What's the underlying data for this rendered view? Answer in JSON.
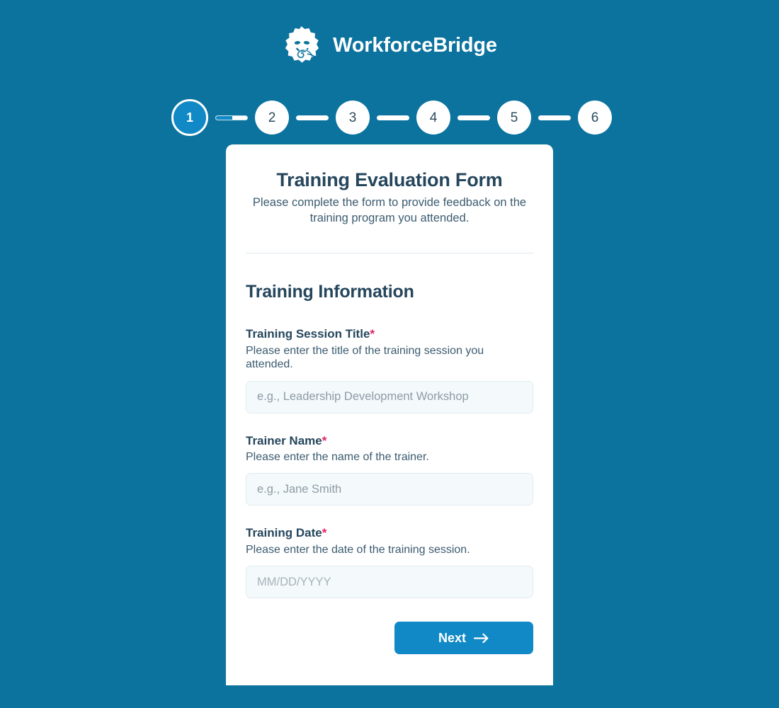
{
  "brand": {
    "name": "WorkforceBridge",
    "logo_icon": "gear-face-logo-icon"
  },
  "stepper": {
    "current_step": 1,
    "total_steps": 6,
    "steps": [
      {
        "label": "1",
        "state": "active"
      },
      {
        "label": "2",
        "state": "upcoming"
      },
      {
        "label": "3",
        "state": "upcoming"
      },
      {
        "label": "4",
        "state": "upcoming"
      },
      {
        "label": "5",
        "state": "upcoming"
      },
      {
        "label": "6",
        "state": "upcoming"
      }
    ]
  },
  "form": {
    "title": "Training Evaluation Form",
    "subtitle": "Please complete the form to provide feedback on the training program you attended.",
    "section_heading": "Training Information",
    "required_marker": "*",
    "fields": [
      {
        "label": "Training Session Title",
        "help": "Please enter the title of the training session you attended.",
        "placeholder": "e.g., Leadership Development Workshop",
        "value": "",
        "required": true
      },
      {
        "label": "Trainer Name",
        "help": "Please enter the name of the trainer.",
        "placeholder": "e.g., Jane Smith",
        "value": "",
        "required": true
      },
      {
        "label": "Training Date",
        "help": "Please enter the date of the training session.",
        "placeholder": "MM/DD/YYYY",
        "value": "",
        "required": true
      }
    ],
    "next_label": "Next",
    "next_icon": "arrow-right-icon"
  },
  "colors": {
    "page_background": "#0b739e",
    "accent_blue": "#1189c6",
    "heading_text": "#25465c",
    "body_text": "#3b5b70",
    "required_star": "#e51f62",
    "input_background": "#f4f9fb",
    "input_border": "#e2edf2",
    "card_background": "#ffffff"
  }
}
